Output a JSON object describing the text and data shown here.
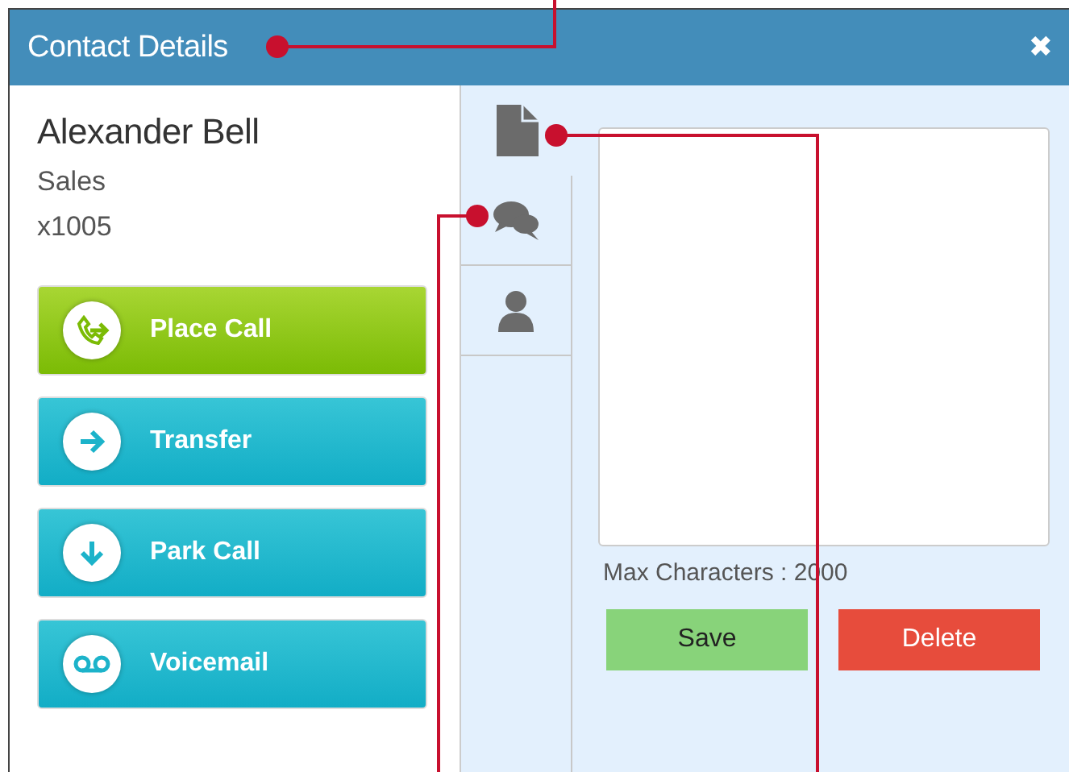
{
  "window": {
    "title": "Contact Details",
    "close": "✖"
  },
  "contact": {
    "name": "Alexander Bell",
    "department": "Sales",
    "extension": "x1005"
  },
  "actions": [
    {
      "label": "Place Call",
      "kind": "call"
    },
    {
      "label": "Transfer",
      "kind": "transfer"
    },
    {
      "label": "Park Call",
      "kind": "park"
    },
    {
      "label": "Voicemail",
      "kind": "voicemail"
    }
  ],
  "tabs": [
    {
      "kind": "notes",
      "selected": true
    },
    {
      "kind": "chat",
      "selected": false
    },
    {
      "kind": "person",
      "selected": false
    }
  ],
  "notes": {
    "limit": "Max Characters : 2000",
    "buttons": [
      {
        "label": "Save",
        "kind": "save"
      },
      {
        "label": "Delete",
        "kind": "delete"
      }
    ]
  },
  "callouts": [
    {
      "kind": "title"
    },
    {
      "kind": "notes-tab"
    },
    {
      "kind": "chat-tab"
    }
  ]
}
